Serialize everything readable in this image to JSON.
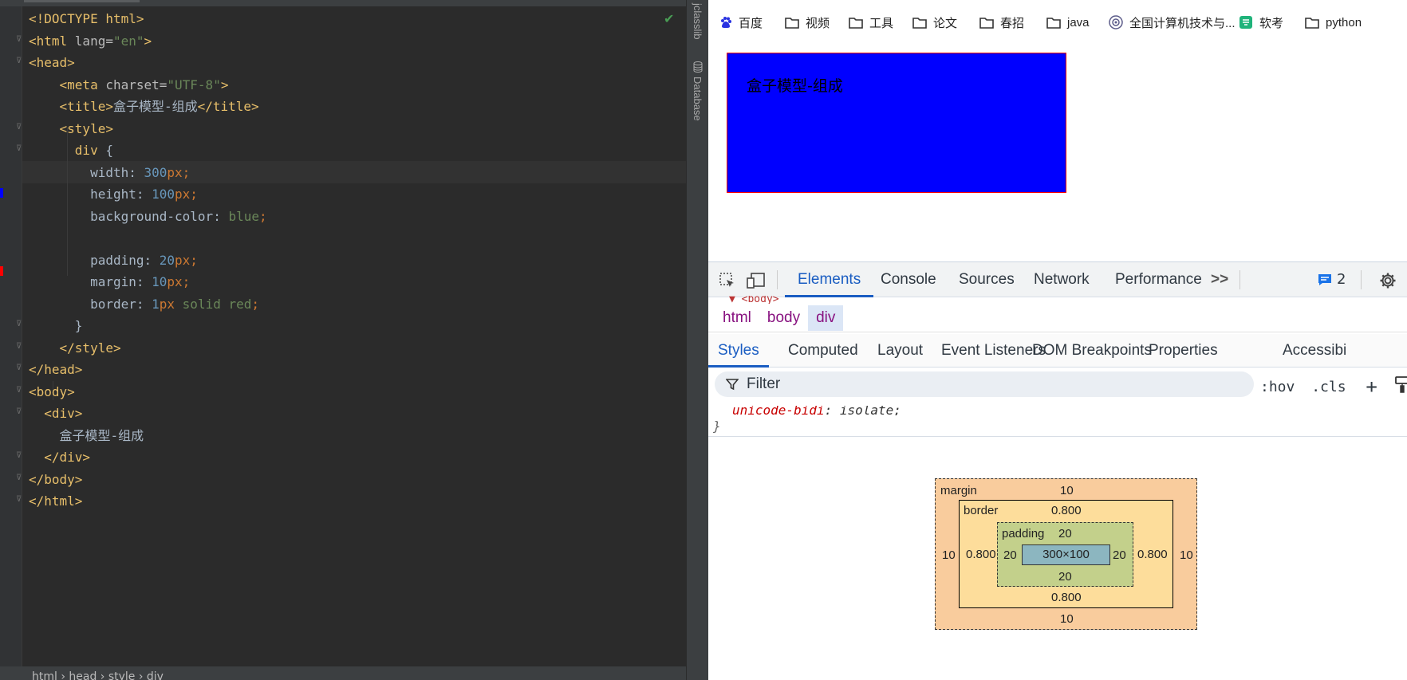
{
  "editor": {
    "lines": [
      {
        "n": 1,
        "html": "<span class='tag'>&lt;!DOCTYPE html&gt;</span>"
      },
      {
        "n": 2,
        "html": "<span class='tag'>&lt;html </span><span class='attr'>lang=</span><span class='str'>\"en\"</span><span class='tag'>&gt;</span>"
      },
      {
        "n": 3,
        "html": "<span class='tag'>&lt;head&gt;</span>"
      },
      {
        "n": 4,
        "html": "    <span class='tag'>&lt;meta </span><span class='attr'>charset=</span><span class='str'>\"UTF-8\"</span><span class='tag'>&gt;</span>"
      },
      {
        "n": 5,
        "html": "    <span class='tag'>&lt;title&gt;</span>盒子模型-组成<span class='tag'>&lt;/title&gt;</span>"
      },
      {
        "n": 6,
        "html": "    <span class='tag'>&lt;style&gt;</span>"
      },
      {
        "n": 7,
        "html": "      <span class='sel'>div</span> {"
      },
      {
        "n": 8,
        "html": "        width: <span class='num'>300</span><span class='unit'>px</span><span class='semi'>;</span>"
      },
      {
        "n": 9,
        "html": "        height: <span class='num'>100</span><span class='unit'>px</span><span class='semi'>;</span>"
      },
      {
        "n": 10,
        "html": "        background-color: <span class='kw'>blue</span><span class='semi'>;</span>"
      },
      {
        "n": 11,
        "html": ""
      },
      {
        "n": 12,
        "html": "        padding: <span class='num'>20</span><span class='unit'>px</span><span class='semi'>;</span>"
      },
      {
        "n": 13,
        "html": "        margin: <span class='num'>10</span><span class='unit'>px</span><span class='semi'>;</span>"
      },
      {
        "n": 14,
        "html": "        border: <span class='num'>1</span><span class='unit'>px </span><span class='kw'>solid red</span><span class='semi'>;</span>"
      },
      {
        "n": 15,
        "html": "      }"
      },
      {
        "n": 16,
        "html": "    <span class='tag'>&lt;/style&gt;</span>"
      },
      {
        "n": 17,
        "html": "<span class='tag'>&lt;/head&gt;</span>"
      },
      {
        "n": 18,
        "html": "<span class='tag'>&lt;body&gt;</span>"
      },
      {
        "n": 19,
        "html": "  <span class='tag'>&lt;div&gt;</span>"
      },
      {
        "n": 20,
        "html": "    盒子模型-组成"
      },
      {
        "n": 21,
        "html": "  <span class='tag'>&lt;/div&gt;</span>"
      },
      {
        "n": 22,
        "html": "<span class='tag'>&lt;/body&gt;</span>"
      },
      {
        "n": 23,
        "html": "<span class='tag'>&lt;/html&gt;</span>"
      }
    ],
    "status_crumbs": "html  ›  head  ›  style  ›  div",
    "check_icon": "check-icon"
  },
  "toolstrip": {
    "top_label": "jclasslib",
    "db_label": "Database"
  },
  "bookmarks": [
    {
      "label": "百度",
      "icon": "baidu-icon"
    },
    {
      "label": "视频",
      "icon": "folder-icon"
    },
    {
      "label": "工具",
      "icon": "folder-icon"
    },
    {
      "label": "论文",
      "icon": "folder-icon"
    },
    {
      "label": "春招",
      "icon": "folder-icon"
    },
    {
      "label": "java",
      "icon": "folder-icon"
    },
    {
      "label": "全国计算机技术与...",
      "icon": "globe-icon"
    },
    {
      "label": "软考",
      "icon": "ruankao-icon"
    },
    {
      "label": "python",
      "icon": "folder-icon"
    }
  ],
  "demo_box": {
    "text": "盒子模型-组成",
    "background": "#0000ff",
    "border_color": "#ff0000"
  },
  "devtools": {
    "tabs": [
      "Elements",
      "Console",
      "Sources",
      "Network",
      "Performance"
    ],
    "active_tab": "Elements",
    "more": ">>",
    "issues_count": "2",
    "dom_peek": "▼ <body>",
    "breadcrumbs": [
      "html",
      "body",
      "div"
    ],
    "subtabs": [
      "Styles",
      "Computed",
      "Layout",
      "Event Listeners",
      "DOM Breakpoints",
      "Properties",
      "Accessibi"
    ],
    "filter_placeholder": "Filter",
    "hov": ":hov",
    "cls": ".cls",
    "rule_prop": "unicode-bidi",
    "rule_value": "isolate;",
    "close_brace": "}"
  },
  "box_model": {
    "margin_label": "margin",
    "border_label": "border",
    "padding_label": "padding",
    "margin": {
      "top": "10",
      "right": "10",
      "bottom": "10",
      "left": "10"
    },
    "border": {
      "top": "0.800",
      "right": "0.800",
      "bottom": "0.800",
      "left": "0.800"
    },
    "padding": {
      "top": "20",
      "right": "20",
      "bottom": "20",
      "left": "20"
    },
    "content": "300×100"
  }
}
